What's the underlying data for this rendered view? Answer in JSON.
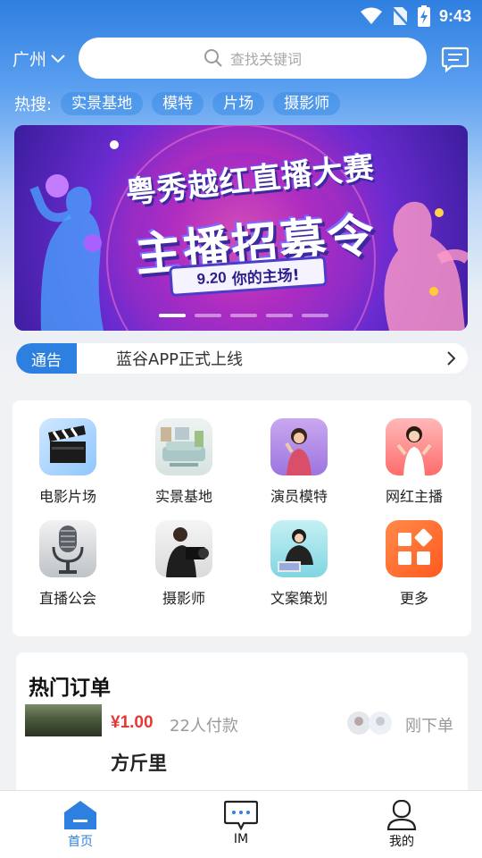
{
  "status_bar": {
    "time": "9:43"
  },
  "header": {
    "city": "广州",
    "search_placeholder": "查找关键词"
  },
  "hot_search": {
    "label": "热搜:",
    "tags": [
      "实景基地",
      "模特",
      "片场",
      "摄影师"
    ]
  },
  "banner": {
    "title_line1": "粤秀越红直播大赛",
    "title_line2": "主播招募令",
    "pill_date": "9.20",
    "pill_text": "你的主场!",
    "slide_count": 5,
    "active_slide": 1
  },
  "notice": {
    "badge": "通告",
    "text": "蓝谷APP正式上线"
  },
  "categories": [
    {
      "label": "电影片场",
      "icon": "clapperboard-icon"
    },
    {
      "label": "实景基地",
      "icon": "living-room-icon"
    },
    {
      "label": "演员模特",
      "icon": "actress-icon"
    },
    {
      "label": "网红主播",
      "icon": "influencer-icon"
    },
    {
      "label": "直播公会",
      "icon": "microphone-icon"
    },
    {
      "label": "摄影师",
      "icon": "photographer-icon"
    },
    {
      "label": "文案策划",
      "icon": "copywriter-icon"
    },
    {
      "label": "更多",
      "icon": "more-grid-icon"
    }
  ],
  "hot_orders": {
    "title": "热门订单",
    "items": [
      {
        "price": "¥1.00",
        "paid": "22人付款",
        "status": "刚下单",
        "name": "方斤里"
      }
    ]
  },
  "bottom_nav": [
    {
      "label": "首页",
      "icon": "home-icon",
      "active": true
    },
    {
      "label": "IM",
      "icon": "chat-icon",
      "active": false
    },
    {
      "label": "我的",
      "icon": "profile-icon",
      "active": false
    }
  ],
  "colors": {
    "primary": "#2d7fe0",
    "price": "#e53935",
    "more_icon": "#ff6a2b"
  }
}
